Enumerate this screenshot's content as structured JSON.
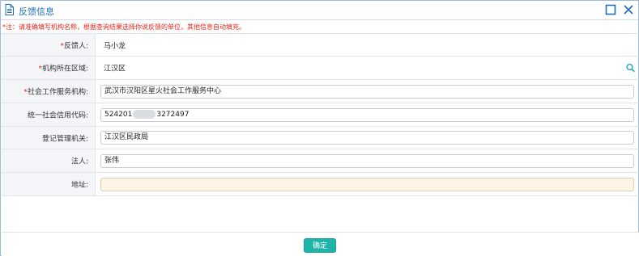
{
  "window": {
    "title": "反馈信息"
  },
  "notice": "*注：请准确填写机构名称，根据查询结果选择你说反馈的单位，其他信息自动填充。",
  "fields": {
    "feedback_person": {
      "required_mark": "*",
      "label": "反馈人:",
      "value": "马小龙"
    },
    "region": {
      "required_mark": "*",
      "label": "机构所在区域:",
      "value": "江汉区"
    },
    "organization": {
      "required_mark": "*",
      "label": "社会工作服务机构:",
      "value": "武汉市汉阳区星火社会工作服务中心"
    },
    "credit_code": {
      "label": "统一社会信用代码:",
      "value_prefix": "524201",
      "value_suffix": "3272497"
    },
    "registration_authority": {
      "label": "登记管理机关:",
      "value": "江汉区民政局"
    },
    "legal_person": {
      "label": "法人:",
      "value": "张伟"
    },
    "address": {
      "label": "地址:",
      "value": ""
    }
  },
  "footer": {
    "confirm_label": "确定"
  },
  "colors": {
    "title": "#1f6fb5",
    "required": "#e8261c",
    "confirm_button": "#1fb4a8",
    "address_bg": "#fdf4e3",
    "search_icon": "#1fa8b8"
  },
  "icons": {
    "title_icon": "document-icon",
    "window_maximize": "maximize-icon",
    "window_close": "close-icon",
    "region_search": "search-icon"
  }
}
